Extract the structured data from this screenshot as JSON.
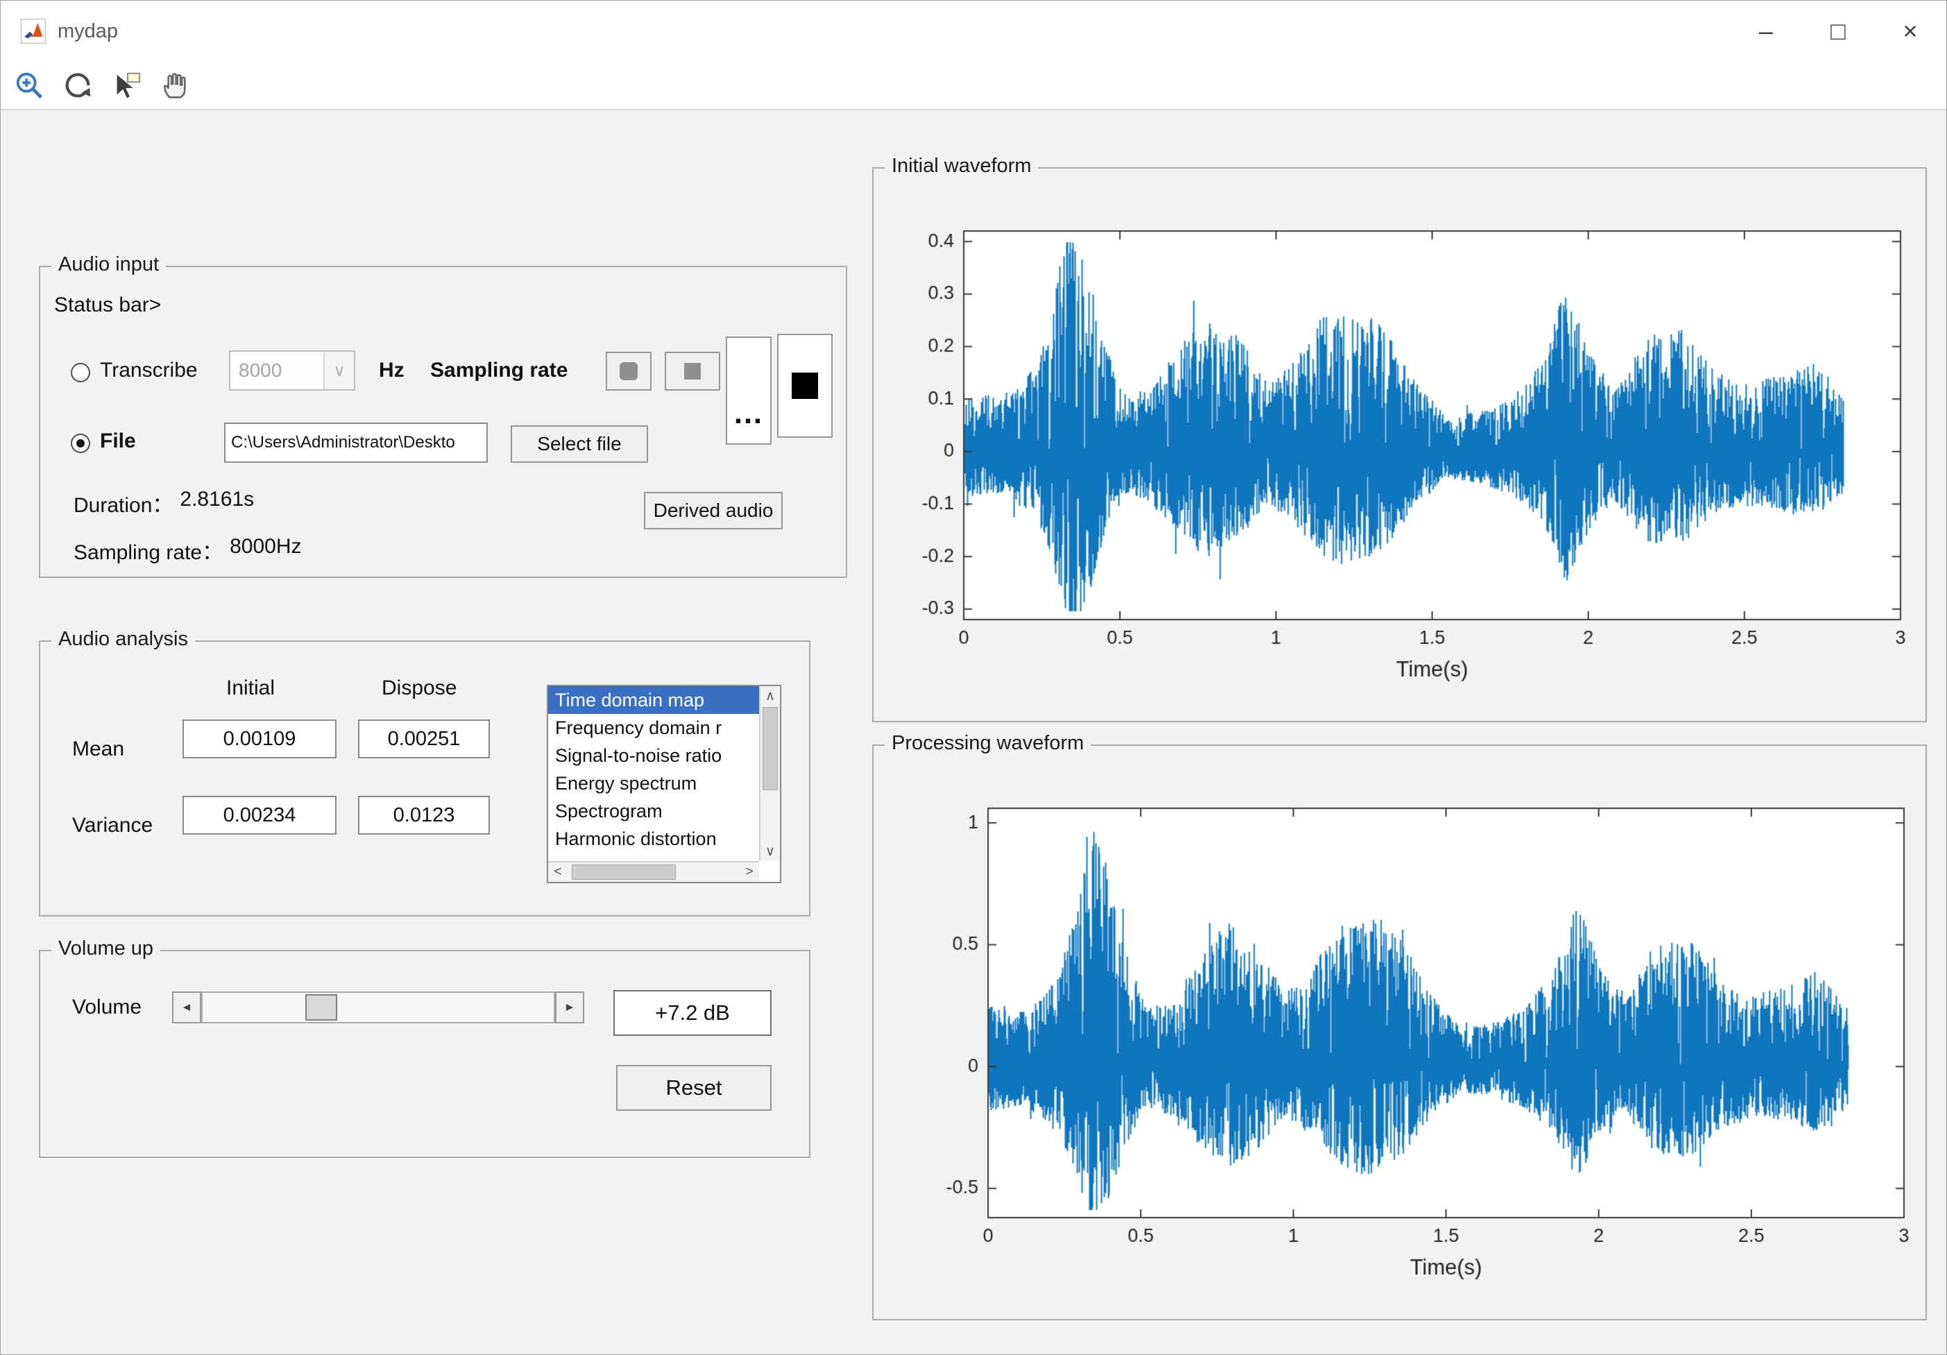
{
  "window": {
    "title": "mydap",
    "minimize_glyph": "–",
    "maximize_glyph": "□",
    "close_glyph": "×"
  },
  "toolbar": {
    "icons": [
      "zoom-in",
      "rotate-3d",
      "data-cursor",
      "pan-hand"
    ]
  },
  "glyphs": {
    "dropdown_chevron": "∨",
    "scroll_up": "∧",
    "scroll_down": "∨",
    "scroll_left": "<",
    "scroll_right": ">",
    "slider_left": "◄",
    "slider_right": "►"
  },
  "audio_input": {
    "title": "Audio input",
    "status_label": "Status bar>",
    "transcribe": {
      "label": "Transcribe",
      "sample_rate_value": "8000",
      "unit_label": "Hz",
      "rate_label": "Sampling rate"
    },
    "buttons": {
      "ellipsis": "…"
    },
    "file": {
      "label": "File",
      "path": "C:\\Users\\Administrator\\Deskto",
      "select_button": "Select file"
    },
    "duration_label": "Duration：",
    "duration_value": "2.8161s",
    "srate_label": "Sampling rate：",
    "srate_value": "8000Hz",
    "derived_button": "Derived audio"
  },
  "audio_analysis": {
    "title": "Audio analysis",
    "columns": {
      "initial": "Initial",
      "dispose": "Dispose"
    },
    "rows": [
      {
        "label": "Mean",
        "initial": "0.00109",
        "dispose": "0.00251"
      },
      {
        "label": "Variance",
        "initial": "0.00234",
        "dispose": "0.0123"
      }
    ],
    "listbox": {
      "items": [
        "Time domain map",
        "Frequency domain r",
        "Signal-to-noise ratio",
        "Energy spectrum",
        "Spectrogram",
        "Harmonic distortion"
      ],
      "selected_index": 0,
      "selection_color": "#3b6fc3"
    }
  },
  "volume": {
    "title": "Volume up",
    "label": "Volume",
    "gain_value": "+7.2 dB",
    "reset_button": "Reset",
    "slider_position": 0.32
  },
  "chart_data": [
    {
      "type": "line",
      "title": "Initial waveform",
      "xlabel": "Time(s)",
      "xlim": [
        0,
        3
      ],
      "ylim": [
        -0.32,
        0.42
      ],
      "xticks": [
        0,
        0.5,
        1,
        1.5,
        2,
        2.5,
        3
      ],
      "yticks": [
        -0.3,
        -0.2,
        -0.1,
        0,
        0.1,
        0.2,
        0.3,
        0.4
      ],
      "signal_duration_s": 2.8161,
      "line_color": "#0f76bd",
      "neg_ratio": 0.78,
      "seed": 1337,
      "envelope": [
        [
          0,
          0.09
        ],
        [
          0.12,
          0.08
        ],
        [
          0.22,
          0.12
        ],
        [
          0.28,
          0.2
        ],
        [
          0.33,
          0.34
        ],
        [
          0.38,
          0.3
        ],
        [
          0.45,
          0.16
        ],
        [
          0.52,
          0.08
        ],
        [
          0.6,
          0.1
        ],
        [
          0.68,
          0.15
        ],
        [
          0.78,
          0.2
        ],
        [
          0.88,
          0.17
        ],
        [
          0.97,
          0.1
        ],
        [
          1.05,
          0.13
        ],
        [
          1.15,
          0.2
        ],
        [
          1.25,
          0.22
        ],
        [
          1.35,
          0.18
        ],
        [
          1.45,
          0.1
        ],
        [
          1.55,
          0.05
        ],
        [
          1.65,
          0.06
        ],
        [
          1.75,
          0.08
        ],
        [
          1.85,
          0.13
        ],
        [
          1.93,
          0.25
        ],
        [
          2.0,
          0.15
        ],
        [
          2.08,
          0.09
        ],
        [
          2.18,
          0.17
        ],
        [
          2.3,
          0.18
        ],
        [
          2.4,
          0.12
        ],
        [
          2.5,
          0.1
        ],
        [
          2.6,
          0.11
        ],
        [
          2.72,
          0.13
        ],
        [
          2.8161,
          0.08
        ]
      ]
    },
    {
      "type": "line",
      "title": "Processing waveform",
      "xlabel": "Time(s)",
      "xlim": [
        0,
        3
      ],
      "ylim": [
        -0.62,
        1.06
      ],
      "xticks": [
        0,
        0.5,
        1,
        1.5,
        2,
        2.5,
        3
      ],
      "yticks": [
        -0.5,
        0,
        0.5,
        1
      ],
      "signal_duration_s": 2.8161,
      "line_color": "#0f76bd",
      "neg_ratio": 0.7,
      "seed": 7331,
      "envelope": [
        [
          0,
          0.2
        ],
        [
          0.12,
          0.18
        ],
        [
          0.22,
          0.28
        ],
        [
          0.28,
          0.46
        ],
        [
          0.33,
          0.78
        ],
        [
          0.38,
          0.68
        ],
        [
          0.45,
          0.36
        ],
        [
          0.52,
          0.18
        ],
        [
          0.6,
          0.23
        ],
        [
          0.68,
          0.34
        ],
        [
          0.78,
          0.46
        ],
        [
          0.88,
          0.39
        ],
        [
          0.97,
          0.23
        ],
        [
          1.05,
          0.3
        ],
        [
          1.15,
          0.46
        ],
        [
          1.25,
          0.5
        ],
        [
          1.35,
          0.41
        ],
        [
          1.45,
          0.23
        ],
        [
          1.55,
          0.12
        ],
        [
          1.65,
          0.14
        ],
        [
          1.75,
          0.18
        ],
        [
          1.85,
          0.3
        ],
        [
          1.93,
          0.52
        ],
        [
          2.0,
          0.34
        ],
        [
          2.08,
          0.21
        ],
        [
          2.18,
          0.39
        ],
        [
          2.3,
          0.41
        ],
        [
          2.4,
          0.28
        ],
        [
          2.5,
          0.23
        ],
        [
          2.6,
          0.25
        ],
        [
          2.72,
          0.3
        ],
        [
          2.8161,
          0.18
        ]
      ]
    }
  ]
}
